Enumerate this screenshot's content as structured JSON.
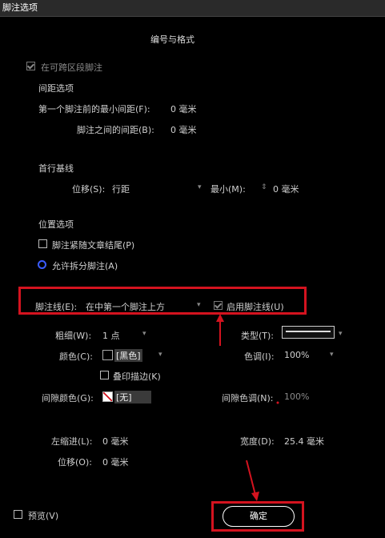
{
  "window": {
    "title": "脚注选项"
  },
  "tabs": {
    "numbering": "编号与格式"
  },
  "options": {
    "span_columns": "在可跨区段脚注",
    "spacing_heading": "间距选项",
    "min_spacing_before": "第一个脚注前的最小间距(F):",
    "min_spacing_before_value": "0 毫米",
    "spacing_between": "脚注之间的间距(B):",
    "spacing_between_value": "0 毫米",
    "first_baseline_heading": "首行基线",
    "offset_label": "位移(S):",
    "offset_value": "行距",
    "min_label": "最小(M):",
    "min_value": "0 毫米",
    "placement_heading": "位置选项",
    "follow_story": "脚注紧随文章结尾(P)",
    "allow_split": "允许拆分脚注(A)"
  },
  "rule": {
    "rule_above_label": "脚注线(E):",
    "rule_above_value": "在中第一个脚注上方",
    "rule_on_label": "启用脚注线(U)",
    "weight_label": "粗细(W):",
    "weight_value": "1 点",
    "type_label": "类型(T):",
    "color_label": "颜色(C):",
    "color_value": "[黑色]",
    "tint_label": "色调(I):",
    "tint_value": "100%",
    "overprint_label": "叠印描边(K)",
    "gap_color_label": "间隙颜色(G):",
    "gap_color_value": "[无]",
    "gap_tint_label": "间隙色调(N):",
    "gap_tint_value": "100%",
    "left_indent_label": "左缩进(L):",
    "left_indent_value": "0 毫米",
    "width_label": "宽度(D):",
    "width_value": "25.4 毫米",
    "offset2_label": "位移(O):",
    "offset2_value": "0 毫米"
  },
  "footer": {
    "preview_label": "预览(V)",
    "ok_label": "确定"
  },
  "colors": {
    "highlight": "#d4131f",
    "radio_on": "#3a5cff"
  }
}
